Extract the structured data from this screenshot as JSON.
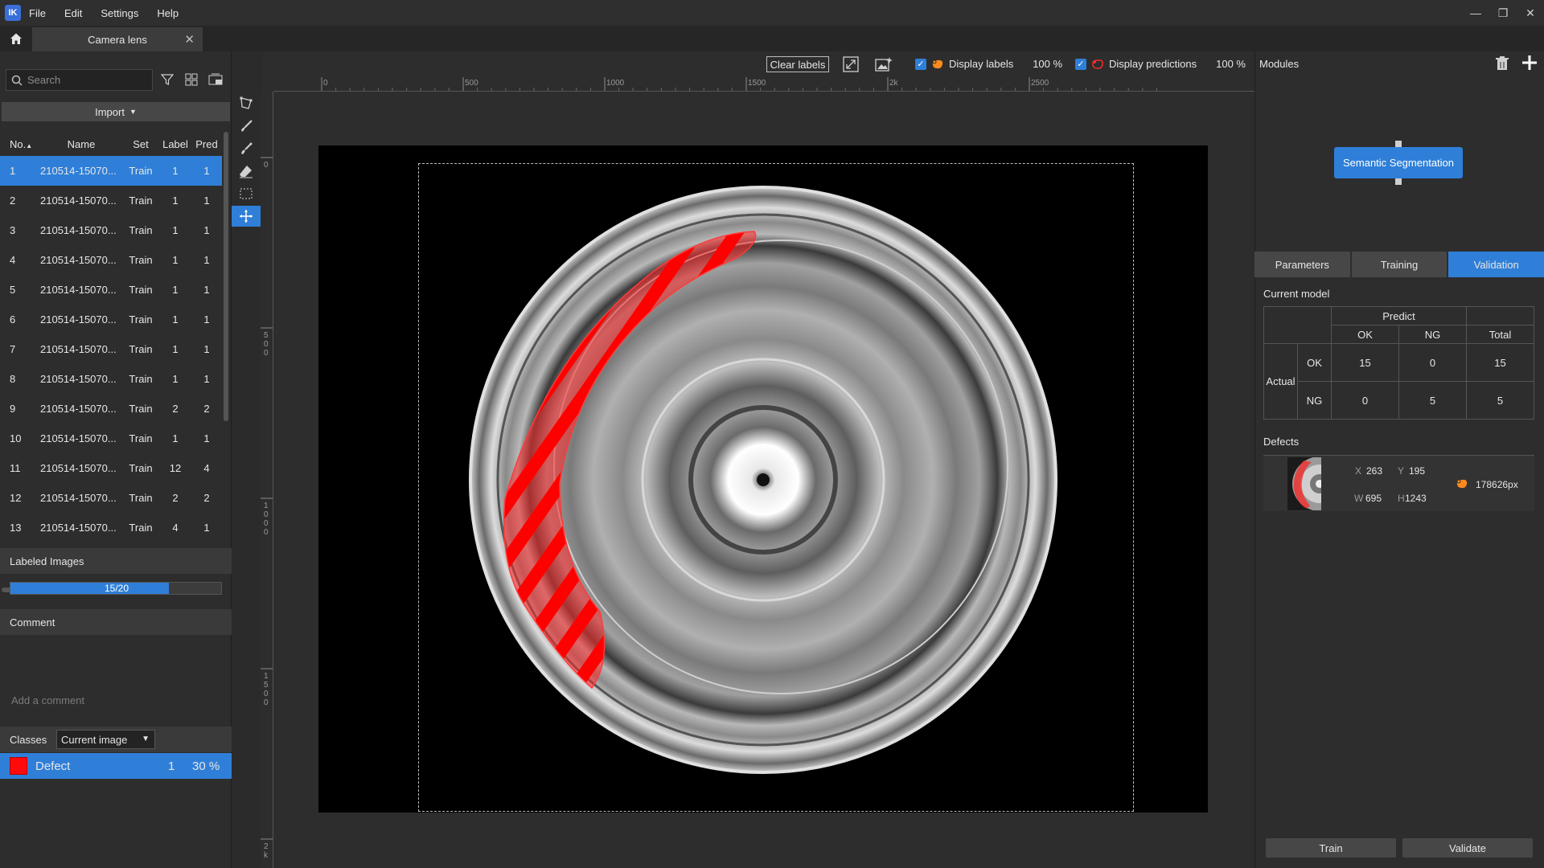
{
  "menubar": {
    "logo": "IK",
    "items": [
      "File",
      "Edit",
      "Settings",
      "Help"
    ]
  },
  "tabs": {
    "document_tab": "Camera lens"
  },
  "left_panel": {
    "search_placeholder": "Search",
    "import_label": "Import",
    "columns": [
      "No.",
      "Name",
      "Set",
      "Label",
      "Pred"
    ],
    "rows": [
      {
        "no": "1",
        "name": "210514-15070...",
        "set": "Train",
        "label": "1",
        "pred": "1",
        "selected": true
      },
      {
        "no": "2",
        "name": "210514-15070...",
        "set": "Train",
        "label": "1",
        "pred": "1"
      },
      {
        "no": "3",
        "name": "210514-15070...",
        "set": "Train",
        "label": "1",
        "pred": "1"
      },
      {
        "no": "4",
        "name": "210514-15070...",
        "set": "Train",
        "label": "1",
        "pred": "1"
      },
      {
        "no": "5",
        "name": "210514-15070...",
        "set": "Train",
        "label": "1",
        "pred": "1"
      },
      {
        "no": "6",
        "name": "210514-15070...",
        "set": "Train",
        "label": "1",
        "pred": "1"
      },
      {
        "no": "7",
        "name": "210514-15070...",
        "set": "Train",
        "label": "1",
        "pred": "1"
      },
      {
        "no": "8",
        "name": "210514-15070...",
        "set": "Train",
        "label": "1",
        "pred": "1"
      },
      {
        "no": "9",
        "name": "210514-15070...",
        "set": "Train",
        "label": "2",
        "pred": "2"
      },
      {
        "no": "10",
        "name": "210514-15070...",
        "set": "Train",
        "label": "1",
        "pred": "1"
      },
      {
        "no": "11",
        "name": "210514-15070...",
        "set": "Train",
        "label": "12",
        "pred": "4"
      },
      {
        "no": "12",
        "name": "210514-15070...",
        "set": "Train",
        "label": "2",
        "pred": "2"
      },
      {
        "no": "13",
        "name": "210514-15070...",
        "set": "Train",
        "label": "4",
        "pred": "1"
      }
    ],
    "labeled_images_title": "Labeled Images",
    "labeled_progress_text": "15/20",
    "labeled_progress_fraction": 0.75,
    "comment_title": "Comment",
    "comment_placeholder": "Add a comment",
    "classes_title": "Classes",
    "classes_scope": "Current image",
    "class": {
      "name": "Defect",
      "count": "1",
      "percent": "30 %",
      "color": "#ff0a0a"
    }
  },
  "toolbar": {
    "clear_labels": "Clear labels",
    "display_labels": "Display labels",
    "display_labels_pct": "100 %",
    "display_predictions": "Display predictions",
    "display_predictions_pct": "100 %"
  },
  "ruler": {
    "top_ticks": [
      "0",
      "500",
      "1000",
      "1500",
      "2k",
      "2500"
    ],
    "left_ticks": [
      "0",
      "500",
      "1000",
      "1500",
      "2k"
    ]
  },
  "right_panel": {
    "modules_title": "Modules",
    "module_node": "Semantic Segmentation",
    "tabs": [
      "Parameters",
      "Training",
      "Validation"
    ],
    "current_model_label": "Current model",
    "confusion": {
      "predict_header": "Predict",
      "ok": "OK",
      "ng": "NG",
      "total": "Total",
      "actual": "Actual",
      "ok_row": [
        "15",
        "0",
        "15"
      ],
      "ng_row": [
        "0",
        "5",
        "5"
      ]
    },
    "defects_label": "Defects",
    "defect": {
      "x_key": "X",
      "x": "263",
      "y_key": "Y",
      "y": "195",
      "w_key": "W",
      "w": "695",
      "h_key": "H",
      "h": "1243",
      "area": "178626px"
    },
    "train_button": "Train",
    "validate_button": "Validate"
  },
  "colors": {
    "accent": "#2f7fd8",
    "defect": "#ff0a0a",
    "label_icon": "#ff8a1e"
  }
}
